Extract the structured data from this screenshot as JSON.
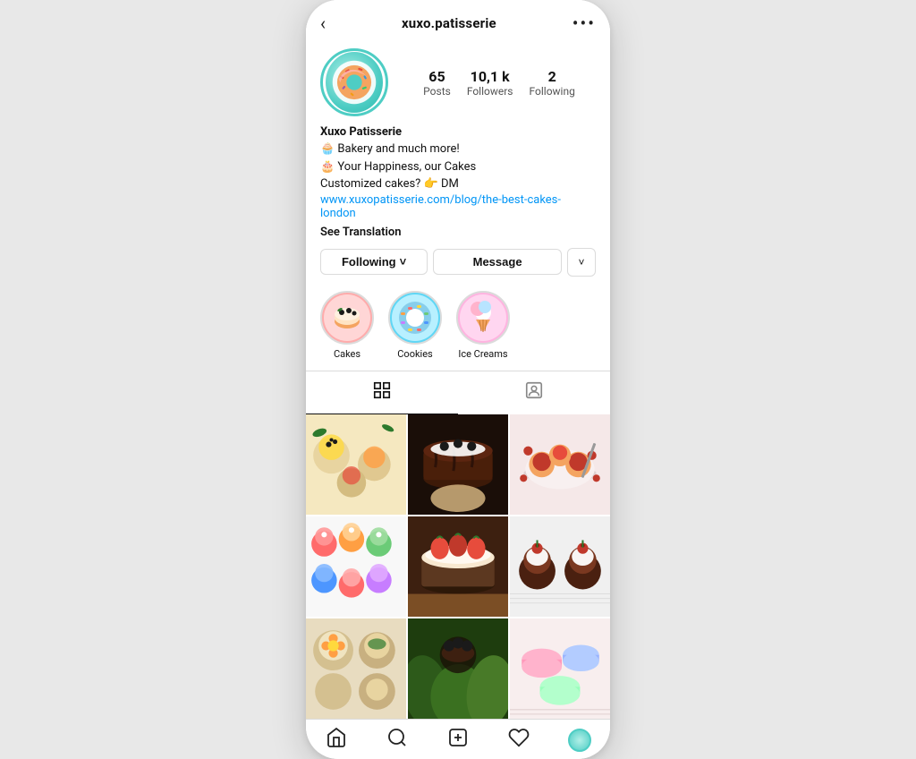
{
  "header": {
    "back_label": "‹",
    "title": "xuxo.patisserie",
    "more_label": "•••"
  },
  "profile": {
    "username": "Xuxo Patisserie",
    "stats": [
      {
        "number": "65",
        "label": "Posts"
      },
      {
        "number": "10,1 k",
        "label": "Followers"
      },
      {
        "number": "2",
        "label": "Following"
      }
    ],
    "bio_lines": [
      "🧁 Bakery and much more!",
      "🎂 Your Happiness, our Cakes",
      "Customized cakes? 👉 DM"
    ],
    "link": "www.xuxopatisserie.com/blog/the-best-cakes-london",
    "see_translation": "See Translation"
  },
  "buttons": {
    "following": "Following",
    "following_arrow": "˅",
    "message": "Message",
    "dropdown_arrow": "˅"
  },
  "highlights": [
    {
      "label": "Cakes"
    },
    {
      "label": "Cookies"
    },
    {
      "label": "Ice Creams"
    }
  ],
  "tabs": [
    {
      "icon": "grid",
      "active": true
    },
    {
      "icon": "person",
      "active": false
    }
  ],
  "nav": [
    {
      "icon": "home",
      "label": "home-icon",
      "active": false
    },
    {
      "icon": "search",
      "label": "search-icon",
      "active": false
    },
    {
      "icon": "plus-square",
      "label": "add-icon",
      "active": false
    },
    {
      "icon": "heart",
      "label": "likes-icon",
      "active": false
    },
    {
      "icon": "profile",
      "label": "profile-icon",
      "active": true
    }
  ],
  "colors": {
    "accent": "#4ecdc4",
    "link": "#0095f6",
    "border": "#dbdbdb",
    "text_primary": "#111",
    "text_secondary": "#555"
  }
}
